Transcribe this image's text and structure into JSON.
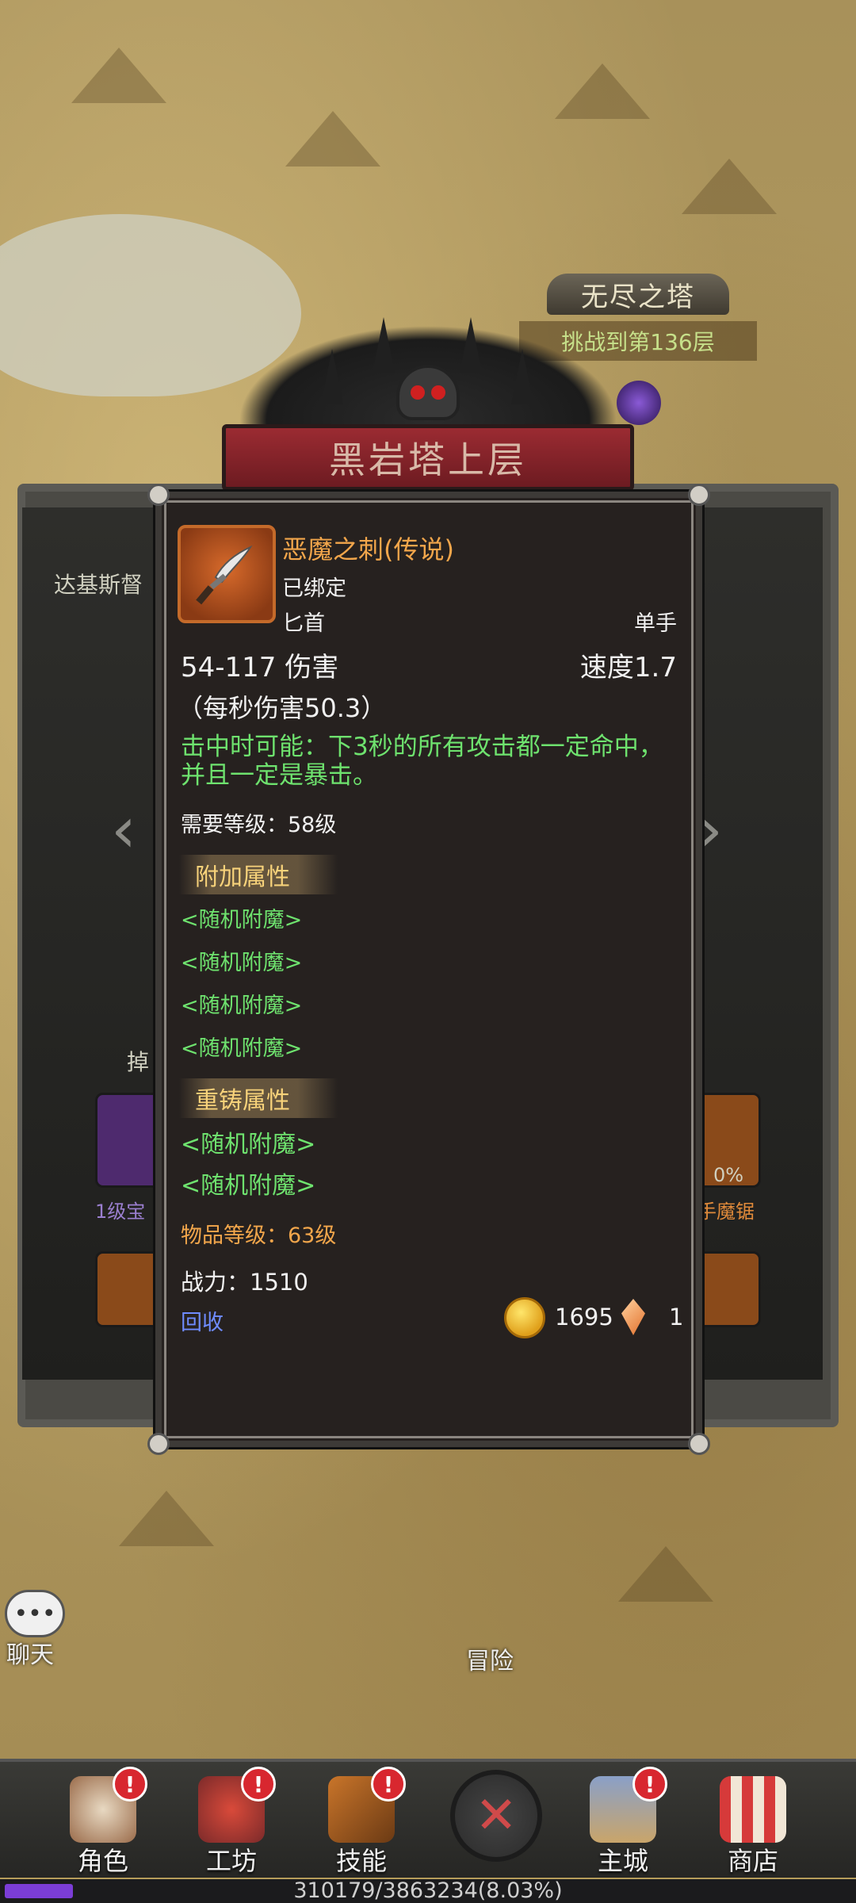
{
  "map": {
    "endless_tower_title": "无尽之塔",
    "endless_tower_progress": "挑战到第136层",
    "dungeon_title": "黑岩塔上层",
    "side_left_label": "达基斯督",
    "drop_label": "掉",
    "left_slot_label": "1级宝",
    "right_slot_label": "手魔锯",
    "right_slot_percent": "0%"
  },
  "item": {
    "name": "恶魔之刺(传说)",
    "bind_status": "已绑定",
    "weapon_type": "匕首",
    "hand": "单手",
    "damage": "54-117 伤害",
    "speed": "速度1.7",
    "dps": "（每秒伤害50.3）",
    "proc": "击中时可能：下3秒的所有攻击都一定命中，并且一定是暴击。",
    "required_level": "需要等级：58级",
    "bonus_header": "附加属性",
    "bonus_enchants": [
      "<随机附魔>",
      "<随机附魔>",
      "<随机附魔>",
      "<随机附魔>"
    ],
    "reforge_header": "重铸属性",
    "reforge_enchants": [
      "<随机附魔>",
      "<随机附魔>"
    ],
    "item_level": "物品等级：63级",
    "power": "战力：1510",
    "recycle": "回收",
    "gold": "1695",
    "gems": "1",
    "icon": "dagger-icon",
    "rarity_color": "#f2a64b"
  },
  "chat": {
    "label": "聊天",
    "icon": "chat-bubble-icon"
  },
  "adventure": {
    "label": "冒险"
  },
  "nav": {
    "items": [
      {
        "label": "角色",
        "icon": "character-icon",
        "badge": "!"
      },
      {
        "label": "工坊",
        "icon": "workshop-icon",
        "badge": "!"
      },
      {
        "label": "技能",
        "icon": "skills-book-icon",
        "badge": "!"
      },
      {
        "label": "主城",
        "icon": "castle-icon",
        "badge": "!"
      },
      {
        "label": "商店",
        "icon": "shop-icon",
        "badge": ""
      }
    ],
    "center_icon": "close-icon"
  },
  "xp": {
    "text": "310179/3863234(8.03%)",
    "fraction": 0.0803
  }
}
